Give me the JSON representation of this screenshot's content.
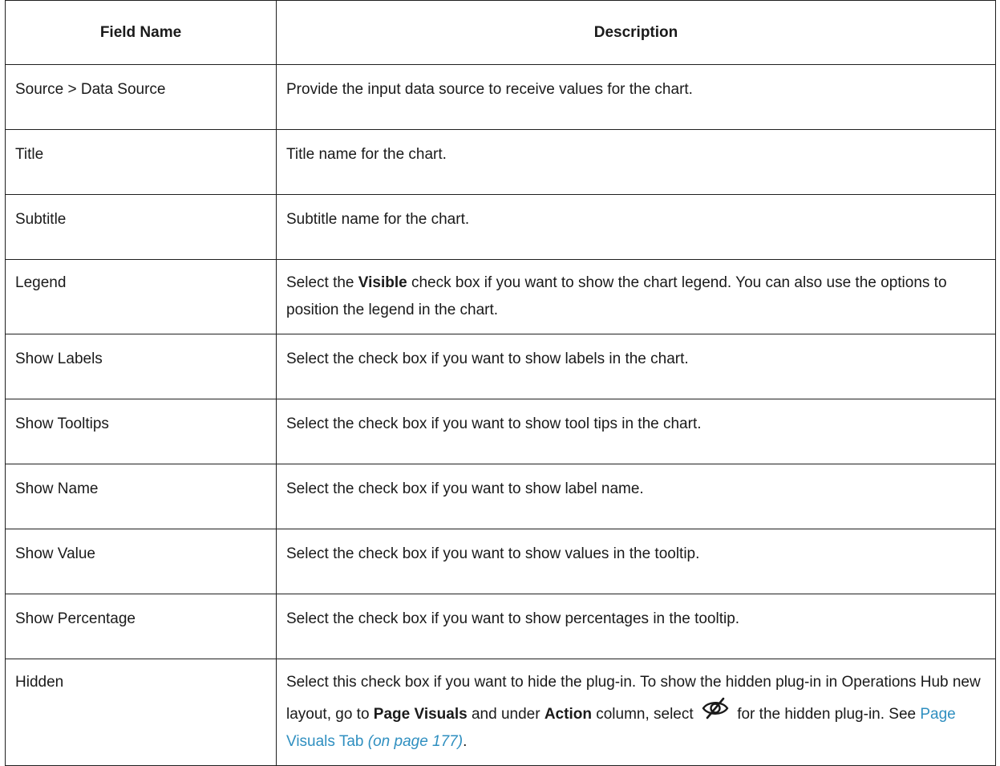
{
  "header": {
    "field_name": "Field Name",
    "description": "Description"
  },
  "rows": [
    {
      "name": "Source > Data Source",
      "desc": "Provide the input data source to receive values for the chart."
    },
    {
      "name": "Title",
      "desc": "Title name for the chart."
    },
    {
      "name": "Subtitle",
      "desc": "Subtitle name for the chart."
    },
    {
      "name": "Legend",
      "desc_pre": "Select the ",
      "desc_bold": "Visible",
      "desc_post": " check box if you want to show the chart legend. You can also use the options to position the legend in the chart."
    },
    {
      "name": "Show Labels",
      "desc": "Select the check box if you want to show labels in the chart."
    },
    {
      "name": "Show Tooltips",
      "desc": "Select the check box if you want to show tool tips in the chart."
    },
    {
      "name": "Show Name",
      "desc": "Select the check box if you want to show label name."
    },
    {
      "name": "Show Value",
      "desc": "Select the check box if you want to show values in the tooltip."
    },
    {
      "name": "Show Percentage",
      "desc": "Select the check box if you want to show percentages in the tooltip."
    },
    {
      "name": "Hidden",
      "desc_part1": "Select this check box if you want to hide the plug-in. To show the hidden plug-in in Operations Hub new layout, go to ",
      "desc_bold1": "Page Visuals",
      "desc_part2": " and under ",
      "desc_bold2": "Action",
      "desc_part3": " column, select ",
      "icon": "eye-slash-icon",
      "desc_part4": " for the hidden plug-in. See ",
      "link_text": "Page Visuals Tab",
      "link_ref": "(on page 177)",
      "desc_end": "."
    }
  ],
  "colors": {
    "link": "#2f8fc0",
    "border": "#1f1f1f"
  }
}
